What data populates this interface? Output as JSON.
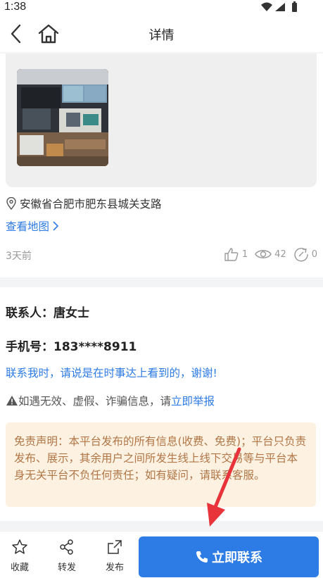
{
  "status_bar": {
    "time": "1:38"
  },
  "nav": {
    "title": "详情"
  },
  "listing": {
    "address": "安徽省合肥市肥东县城关支路",
    "map_link": "查看地图",
    "posted": "3天前",
    "likes": "1",
    "views": "42",
    "shares": "0"
  },
  "contact": {
    "name": "联系人：唐女士",
    "phone": "手机号：183****8911",
    "tip": "联系我时，请说是在时事达上看到的，谢谢!",
    "report_prefix": "如遇无效、虚假、诈骗信息，请",
    "report_link": "立即举报"
  },
  "disclaimer": "免责声明：本平台发布的所有信息(收费、免费)；平台只负责发布、展示，其余用户之间所发生线上线下交易等与平台本身无关平台不负任何责任；如有疑问，请联系客服。",
  "bottom_bar": {
    "favorite": "收藏",
    "share": "转发",
    "publish": "发布",
    "contact_now": "立即联系"
  },
  "colors": {
    "accent": "#2d7be5",
    "disclaimer_bg": "#fdf1e2",
    "disclaimer_text": "#b07646",
    "annotation_arrow": "#e8333a"
  }
}
